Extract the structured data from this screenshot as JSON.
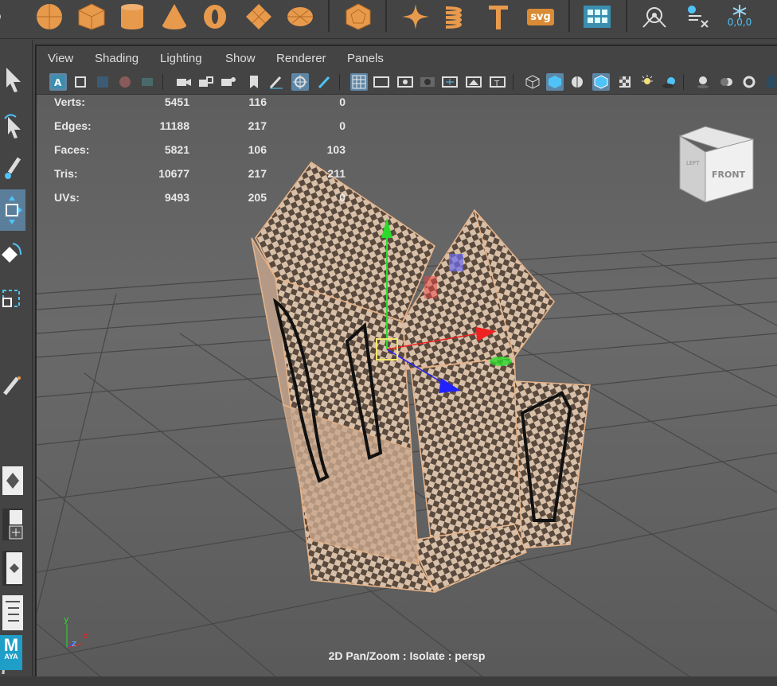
{
  "shelf": {
    "icons": [
      "sphere-icon",
      "cube-icon",
      "cylinder-icon",
      "cone-icon",
      "torus-icon",
      "plane-icon",
      "disc-icon",
      "platonic-icon",
      "super-shape-icon",
      "helix-icon",
      "type-icon",
      "svg-icon",
      "grid-layout-icon",
      "camera-rig-icon",
      "delete-history-icon",
      "freeze-transform-icon"
    ],
    "svg_label": "svg",
    "freeze_label": "0,0,0"
  },
  "panel_menu": [
    "View",
    "Shading",
    "Lighting",
    "Show",
    "Renderer",
    "Panels"
  ],
  "hud": {
    "rows": [
      {
        "label": "Verts:",
        "a": "5451",
        "b": "116",
        "c": "0"
      },
      {
        "label": "Edges:",
        "a": "11188",
        "b": "217",
        "c": "0"
      },
      {
        "label": "Faces:",
        "a": "5821",
        "b": "106",
        "c": "103"
      },
      {
        "label": "Tris:",
        "a": "10677",
        "b": "217",
        "c": "211"
      },
      {
        "label": "UVs:",
        "a": "9493",
        "b": "205",
        "c": "0"
      }
    ]
  },
  "viewcube": {
    "front": "FRONT",
    "left": "LEFT"
  },
  "axis": {
    "x": "x",
    "y": "y",
    "z": "z"
  },
  "status": "2D Pan/Zoom : Isolate : persp",
  "logo": {
    "letter": "M",
    "word": "AYA"
  },
  "colors": {
    "accent_orange": "#e89a4c",
    "active_blue": "#5d86a6",
    "viewport_bg": "#5f5f5f"
  }
}
